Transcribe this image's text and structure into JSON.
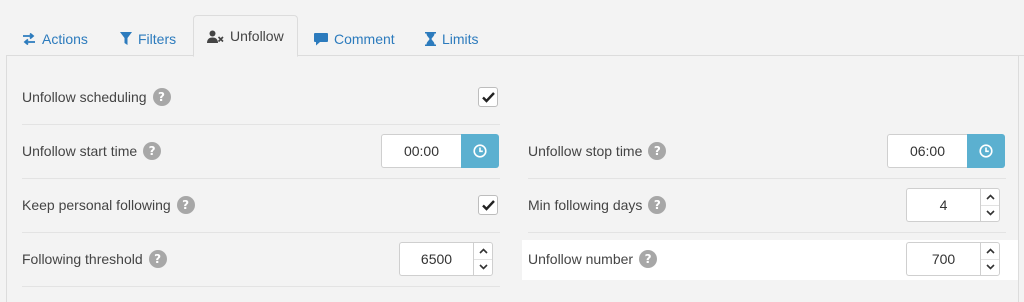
{
  "tabs": [
    {
      "label": "Actions",
      "icon": "exchange-icon"
    },
    {
      "label": "Filters",
      "icon": "filter-icon"
    },
    {
      "label": "Unfollow",
      "icon": "user-remove-icon",
      "active": true
    },
    {
      "label": "Comment",
      "icon": "comment-icon"
    },
    {
      "label": "Limits",
      "icon": "hourglass-icon"
    }
  ],
  "settings": {
    "unfollow_scheduling": {
      "label": "Unfollow scheduling",
      "checked": true
    },
    "unfollow_start_time": {
      "label": "Unfollow start time",
      "value": "00:00"
    },
    "unfollow_stop_time": {
      "label": "Unfollow stop time",
      "value": "06:00"
    },
    "keep_personal_following": {
      "label": "Keep personal following",
      "checked": true
    },
    "min_following_days": {
      "label": "Min following days",
      "value": "4"
    },
    "following_threshold": {
      "label": "Following threshold",
      "value": "6500"
    },
    "unfollow_number": {
      "label": "Unfollow number",
      "value": "700"
    }
  },
  "help_glyph": "?",
  "colors": {
    "accent": "#5bb0d0",
    "link": "#2c7bbd",
    "help": "#a7a7a7"
  }
}
